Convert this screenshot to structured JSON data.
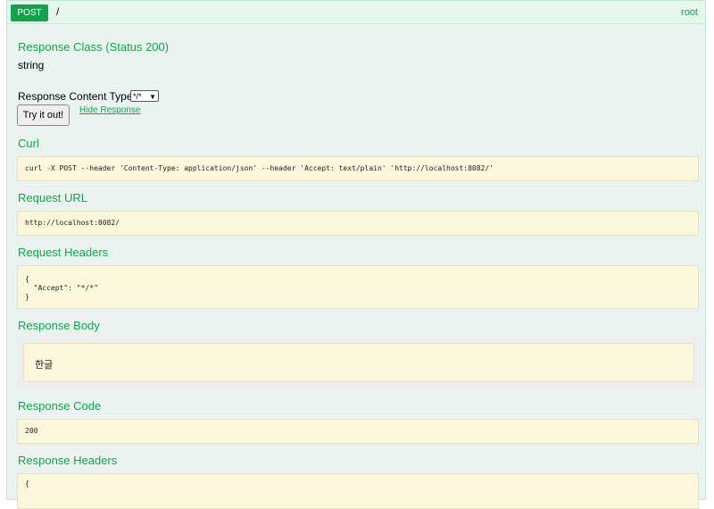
{
  "header": {
    "method": "POST",
    "path": "/",
    "root_link": "root"
  },
  "response_class": {
    "heading": "Response Class (Status 200)",
    "type": "string"
  },
  "content_type": {
    "label": "Response Content Type",
    "selected": "*/*"
  },
  "actions": {
    "try_label": "Try it out!",
    "hide_label": "Hide Response"
  },
  "sections": {
    "curl": {
      "heading": "Curl",
      "value": "curl -X POST --header 'Content-Type: application/json' --header 'Accept: text/plain' 'http://localhost:8082/'"
    },
    "request_url": {
      "heading": "Request URL",
      "value": "http://localhost:8082/"
    },
    "request_headers": {
      "heading": "Request Headers",
      "value": "{\n  \"Accept\": \"*/*\"\n}"
    },
    "response_body": {
      "heading": "Response Body",
      "value": "한글"
    },
    "response_code": {
      "heading": "Response Code",
      "value": "200"
    },
    "response_headers": {
      "heading": "Response Headers",
      "value": "{"
    }
  }
}
